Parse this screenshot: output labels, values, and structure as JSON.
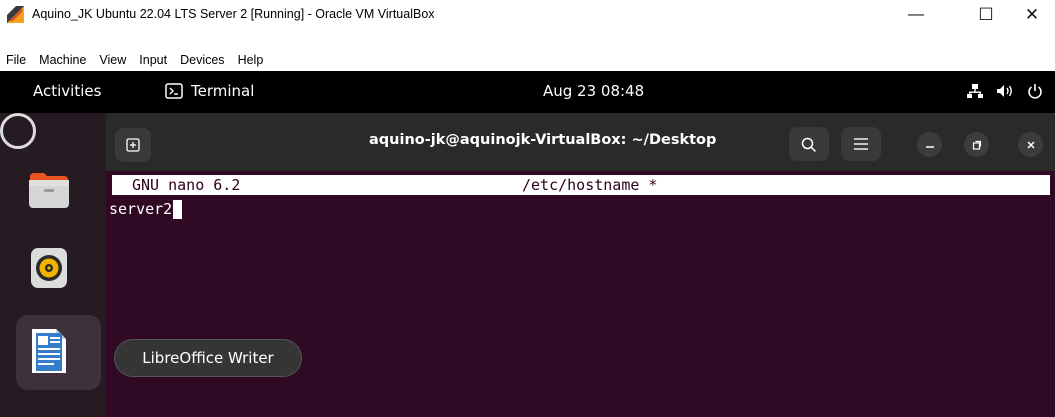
{
  "vbox": {
    "title": "Aquino_JK Ubuntu 22.04 LTS Server 2 [Running] - Oracle VM VirtualBox",
    "controls": {
      "minimize": "—",
      "maximize": "☐",
      "close": "✕"
    },
    "menu": [
      "File",
      "Machine",
      "View",
      "Input",
      "Devices",
      "Help"
    ]
  },
  "topbar": {
    "activities": "Activities",
    "app_name": "Terminal",
    "clock": "Aug 23  08:48"
  },
  "terminal": {
    "title": "aquino-jk@aquinojk-VirtualBox: ~/Desktop",
    "nano": {
      "version": "GNU nano 6.2",
      "filename": "/etc/hostname *",
      "content": "server2"
    }
  },
  "dock": {
    "items": [
      "files-icon",
      "rhythmbox-icon",
      "libreoffice-writer-icon"
    ],
    "tooltip": "LibreOffice Writer"
  },
  "colors": {
    "guest_background": "#2c001e",
    "terminal_background": "#300a24",
    "top_bar": "#000000"
  }
}
